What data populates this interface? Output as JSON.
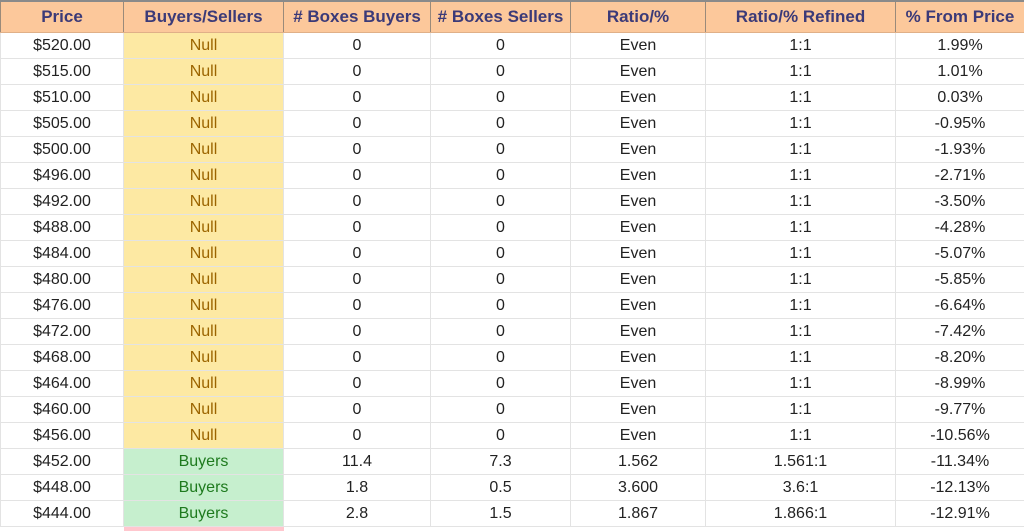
{
  "table": {
    "headers": [
      "Price",
      "Buyers/Sellers",
      "# Boxes Buyers",
      "# Boxes Sellers",
      "Ratio/%",
      "Ratio/% Refined",
      "% From Price"
    ],
    "colors": {
      "header_bg": "#fcc89b",
      "header_text": "#3b3a78",
      "null_bg": "#fde9a3",
      "null_text": "#9c6500",
      "buyers_bg": "#c6efce",
      "buyers_text": "#1e7a1e",
      "sellers_bg": "#ffc7ce"
    },
    "rows": [
      {
        "price": "$520.00",
        "side": "Null",
        "boxes_buyers": "0",
        "boxes_sellers": "0",
        "ratio": "Even",
        "ratio_refined": "1:1",
        "pct_from_price": "1.99%"
      },
      {
        "price": "$515.00",
        "side": "Null",
        "boxes_buyers": "0",
        "boxes_sellers": "0",
        "ratio": "Even",
        "ratio_refined": "1:1",
        "pct_from_price": "1.01%"
      },
      {
        "price": "$510.00",
        "side": "Null",
        "boxes_buyers": "0",
        "boxes_sellers": "0",
        "ratio": "Even",
        "ratio_refined": "1:1",
        "pct_from_price": "0.03%"
      },
      {
        "price": "$505.00",
        "side": "Null",
        "boxes_buyers": "0",
        "boxes_sellers": "0",
        "ratio": "Even",
        "ratio_refined": "1:1",
        "pct_from_price": "-0.95%"
      },
      {
        "price": "$500.00",
        "side": "Null",
        "boxes_buyers": "0",
        "boxes_sellers": "0",
        "ratio": "Even",
        "ratio_refined": "1:1",
        "pct_from_price": "-1.93%"
      },
      {
        "price": "$496.00",
        "side": "Null",
        "boxes_buyers": "0",
        "boxes_sellers": "0",
        "ratio": "Even",
        "ratio_refined": "1:1",
        "pct_from_price": "-2.71%"
      },
      {
        "price": "$492.00",
        "side": "Null",
        "boxes_buyers": "0",
        "boxes_sellers": "0",
        "ratio": "Even",
        "ratio_refined": "1:1",
        "pct_from_price": "-3.50%"
      },
      {
        "price": "$488.00",
        "side": "Null",
        "boxes_buyers": "0",
        "boxes_sellers": "0",
        "ratio": "Even",
        "ratio_refined": "1:1",
        "pct_from_price": "-4.28%"
      },
      {
        "price": "$484.00",
        "side": "Null",
        "boxes_buyers": "0",
        "boxes_sellers": "0",
        "ratio": "Even",
        "ratio_refined": "1:1",
        "pct_from_price": "-5.07%"
      },
      {
        "price": "$480.00",
        "side": "Null",
        "boxes_buyers": "0",
        "boxes_sellers": "0",
        "ratio": "Even",
        "ratio_refined": "1:1",
        "pct_from_price": "-5.85%"
      },
      {
        "price": "$476.00",
        "side": "Null",
        "boxes_buyers": "0",
        "boxes_sellers": "0",
        "ratio": "Even",
        "ratio_refined": "1:1",
        "pct_from_price": "-6.64%"
      },
      {
        "price": "$472.00",
        "side": "Null",
        "boxes_buyers": "0",
        "boxes_sellers": "0",
        "ratio": "Even",
        "ratio_refined": "1:1",
        "pct_from_price": "-7.42%"
      },
      {
        "price": "$468.00",
        "side": "Null",
        "boxes_buyers": "0",
        "boxes_sellers": "0",
        "ratio": "Even",
        "ratio_refined": "1:1",
        "pct_from_price": "-8.20%"
      },
      {
        "price": "$464.00",
        "side": "Null",
        "boxes_buyers": "0",
        "boxes_sellers": "0",
        "ratio": "Even",
        "ratio_refined": "1:1",
        "pct_from_price": "-8.99%"
      },
      {
        "price": "$460.00",
        "side": "Null",
        "boxes_buyers": "0",
        "boxes_sellers": "0",
        "ratio": "Even",
        "ratio_refined": "1:1",
        "pct_from_price": "-9.77%"
      },
      {
        "price": "$456.00",
        "side": "Null",
        "boxes_buyers": "0",
        "boxes_sellers": "0",
        "ratio": "Even",
        "ratio_refined": "1:1",
        "pct_from_price": "-10.56%"
      },
      {
        "price": "$452.00",
        "side": "Buyers",
        "boxes_buyers": "11.4",
        "boxes_sellers": "7.3",
        "ratio": "1.562",
        "ratio_refined": "1.561:1",
        "pct_from_price": "-11.34%"
      },
      {
        "price": "$448.00",
        "side": "Buyers",
        "boxes_buyers": "1.8",
        "boxes_sellers": "0.5",
        "ratio": "3.600",
        "ratio_refined": "3.6:1",
        "pct_from_price": "-12.13%"
      },
      {
        "price": "$444.00",
        "side": "Buyers",
        "boxes_buyers": "2.8",
        "boxes_sellers": "1.5",
        "ratio": "1.867",
        "ratio_refined": "1.866:1",
        "pct_from_price": "-12.91%"
      }
    ]
  }
}
